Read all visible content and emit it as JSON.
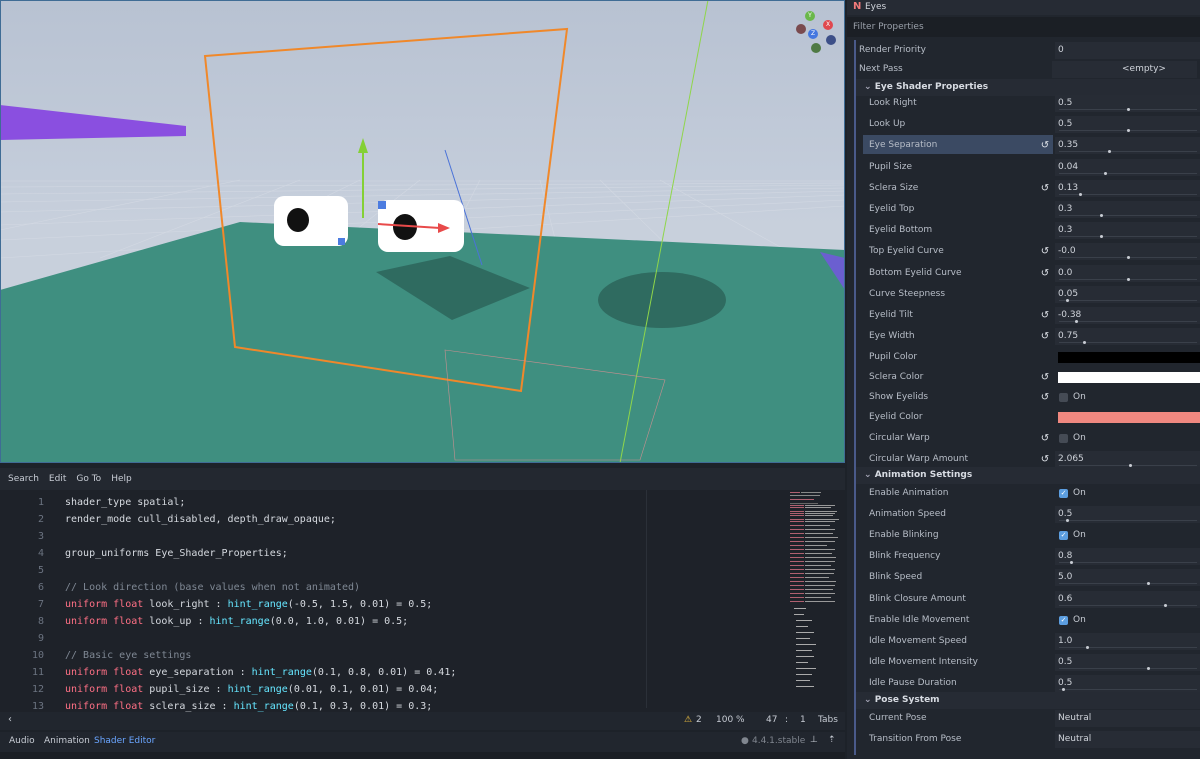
{
  "editor": {
    "menu": [
      "Search",
      "Edit",
      "Go To",
      "Help"
    ],
    "lines": [
      {
        "n": "1",
        "html": "shader_type spatial;"
      },
      {
        "n": "2",
        "html": "render_mode cull_disabled, depth_draw_opaque;"
      },
      {
        "n": "3",
        "html": ""
      },
      {
        "n": "4",
        "html": "group_uniforms Eye_Shader_Properties;"
      },
      {
        "n": "5",
        "html": ""
      },
      {
        "n": "6",
        "html": "<span class='cm'>// Look direction (base values when not animated)</span>"
      },
      {
        "n": "7",
        "html": "<span class='kw'>uniform float</span> look_right : <span class='fn'>hint_range</span>(-0.5, 1.5, 0.01) = 0.5;"
      },
      {
        "n": "8",
        "html": "<span class='kw'>uniform float</span> look_up : <span class='fn'>hint_range</span>(0.0, 1.0, 0.01) = 0.5;"
      },
      {
        "n": "9",
        "html": ""
      },
      {
        "n": "10",
        "html": "<span class='cm'>// Basic eye settings</span>"
      },
      {
        "n": "11",
        "html": "<span class='kw'>uniform float</span> eye_separation : <span class='fn'>hint_range</span>(0.1, 0.8, 0.01) = 0.41;"
      },
      {
        "n": "12",
        "html": "<span class='kw'>uniform float</span> pupil_size : <span class='fn'>hint_range</span>(0.01, 0.1, 0.01) = 0.04;"
      },
      {
        "n": "13",
        "html": "<span class='kw'>uniform float</span> sclera_size : <span class='fn'>hint_range</span>(0.1, 0.3, 0.01) = 0.3;"
      }
    ],
    "status": {
      "warnings": "2",
      "zoom": "100 %",
      "line": "47",
      "col": "1",
      "indent": "Tabs"
    },
    "bottom_tabs": [
      "Audio",
      "Animation",
      "Shader Editor"
    ],
    "version": "4.4.1.stable"
  },
  "inspector": {
    "node_name": "Eyes",
    "filter_placeholder": "Filter Properties",
    "rows": [
      {
        "type": "num",
        "label": "Render Priority",
        "value": "0",
        "slider": null,
        "reset": false,
        "indent": 12
      },
      {
        "type": "text",
        "label": "Next Pass",
        "value": "<empty>",
        "indent": 12
      },
      {
        "type": "section",
        "label": "Eye Shader Properties"
      },
      {
        "type": "num",
        "label": "Look Right",
        "value": "0.5",
        "slider": 0.5,
        "reset": false
      },
      {
        "type": "num",
        "label": "Look Up",
        "value": "0.5",
        "slider": 0.5,
        "reset": false
      },
      {
        "type": "num",
        "label": "Eye Separation",
        "value": "0.35",
        "slider": 0.36,
        "reset": true,
        "highlight": true
      },
      {
        "type": "num",
        "label": "Pupil Size",
        "value": "0.04",
        "slider": 0.33,
        "reset": false
      },
      {
        "type": "num",
        "label": "Sclera Size",
        "value": "0.13",
        "slider": 0.15,
        "reset": true
      },
      {
        "type": "num",
        "label": "Eyelid Top",
        "value": "0.3",
        "slider": 0.3,
        "reset": false
      },
      {
        "type": "num",
        "label": "Eyelid Bottom",
        "value": "0.3",
        "slider": 0.3,
        "reset": false
      },
      {
        "type": "num",
        "label": "Top Eyelid Curve",
        "value": "-0.0",
        "slider": 0.5,
        "reset": true
      },
      {
        "type": "num",
        "label": "Bottom Eyelid Curve",
        "value": "0.0",
        "slider": 0.5,
        "reset": true
      },
      {
        "type": "num",
        "label": "Curve Steepness",
        "value": "0.05",
        "slider": 0.05,
        "reset": false
      },
      {
        "type": "num",
        "label": "Eyelid Tilt",
        "value": "-0.38",
        "slider": 0.12,
        "reset": true
      },
      {
        "type": "num",
        "label": "Eye Width",
        "value": "0.75",
        "slider": 0.18,
        "reset": true
      },
      {
        "type": "color",
        "label": "Pupil Color",
        "color": "#000000",
        "reset": false
      },
      {
        "type": "color",
        "label": "Sclera Color",
        "color": "#ffffff",
        "reset": true
      },
      {
        "type": "check",
        "label": "Show Eyelids",
        "checked": false,
        "text": "On",
        "reset": true
      },
      {
        "type": "color",
        "label": "Eyelid Color",
        "color": "#f08880",
        "reset": false
      },
      {
        "type": "check",
        "label": "Circular Warp",
        "checked": false,
        "text": "On",
        "reset": true
      },
      {
        "type": "num",
        "label": "Circular Warp Amount",
        "value": "2.065",
        "slider": 0.52,
        "reset": true
      },
      {
        "type": "section",
        "label": "Animation Settings"
      },
      {
        "type": "check",
        "label": "Enable Animation",
        "checked": true,
        "text": "On",
        "reset": false
      },
      {
        "type": "num",
        "label": "Animation Speed",
        "value": "0.5",
        "slider": 0.05,
        "reset": false
      },
      {
        "type": "check",
        "label": "Enable Blinking",
        "checked": true,
        "text": "On",
        "reset": false
      },
      {
        "type": "num",
        "label": "Blink Frequency",
        "value": "0.8",
        "slider": 0.08,
        "reset": false
      },
      {
        "type": "num",
        "label": "Blink Speed",
        "value": "5.0",
        "slider": 0.65,
        "reset": false
      },
      {
        "type": "num",
        "label": "Blink Closure Amount",
        "value": "0.6",
        "slider": 0.78,
        "reset": false
      },
      {
        "type": "check",
        "label": "Enable Idle Movement",
        "checked": true,
        "text": "On",
        "reset": false
      },
      {
        "type": "num",
        "label": "Idle Movement Speed",
        "value": "1.0",
        "slider": 0.2,
        "reset": false
      },
      {
        "type": "num",
        "label": "Idle Movement Intensity",
        "value": "0.5",
        "slider": 0.65,
        "reset": false
      },
      {
        "type": "num",
        "label": "Idle Pause Duration",
        "value": "0.5",
        "slider": 0.02,
        "reset": false
      },
      {
        "type": "section",
        "label": "Pose System"
      },
      {
        "type": "text",
        "label": "Current Pose",
        "value": "Neutral",
        "align": "left"
      },
      {
        "type": "text",
        "label": "Transition From Pose",
        "value": "Neutral",
        "align": "left"
      }
    ]
  },
  "gizmo": {
    "x": "X",
    "y": "Y",
    "z": "Z"
  }
}
